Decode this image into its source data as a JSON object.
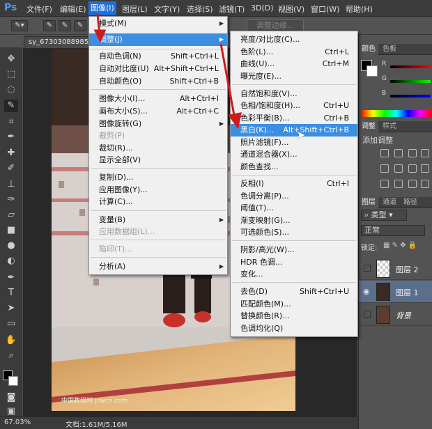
{
  "app": {
    "logo": "Ps"
  },
  "menubar": [
    {
      "label": "文件(F)"
    },
    {
      "label": "编辑(E)"
    },
    {
      "label": "图像(I)"
    },
    {
      "label": "图层(L)"
    },
    {
      "label": "文字(Y)"
    },
    {
      "label": "选择(S)"
    },
    {
      "label": "滤镜(T)"
    },
    {
      "label": "3D(D)"
    },
    {
      "label": "视图(V)"
    },
    {
      "label": "窗口(W)"
    },
    {
      "label": "帮助(H)"
    }
  ],
  "options_bar": {
    "refine_edge": "调整边缘..."
  },
  "document": {
    "tab_title": "sy_67303088985.jpg",
    "watermark": "中国教程网 jcwcn.com"
  },
  "status": {
    "zoom": "67.03%",
    "doc_info": "文档:1.61M/5.16M"
  },
  "image_menu": {
    "items": [
      {
        "label": "模式(M)",
        "shortcut": "",
        "submenu": true
      },
      {
        "label": "调整(J)",
        "shortcut": "",
        "submenu": true,
        "highlighted": true
      },
      {
        "label": "自动色调(N)",
        "shortcut": "Shift+Ctrl+L"
      },
      {
        "label": "自动对比度(U)",
        "shortcut": "Alt+Shift+Ctrl+L"
      },
      {
        "label": "自动颜色(O)",
        "shortcut": "Shift+Ctrl+B"
      },
      {
        "label": "图像大小(I)...",
        "shortcut": "Alt+Ctrl+I"
      },
      {
        "label": "画布大小(S)...",
        "shortcut": "Alt+Ctrl+C"
      },
      {
        "label": "图像旋转(G)",
        "shortcut": "",
        "submenu": true
      },
      {
        "label": "裁剪(P)",
        "shortcut": "",
        "disabled": true
      },
      {
        "label": "裁切(R)...",
        "shortcut": ""
      },
      {
        "label": "显示全部(V)",
        "shortcut": ""
      },
      {
        "label": "复制(D)...",
        "shortcut": ""
      },
      {
        "label": "应用图像(Y)...",
        "shortcut": ""
      },
      {
        "label": "计算(C)...",
        "shortcut": ""
      },
      {
        "label": "变量(B)",
        "shortcut": "",
        "submenu": true
      },
      {
        "label": "应用数据组(L)...",
        "shortcut": "",
        "disabled": true
      },
      {
        "label": "陷印(T)...",
        "shortcut": "",
        "disabled": true
      },
      {
        "label": "分析(A)",
        "shortcut": "",
        "submenu": true
      }
    ]
  },
  "adjust_menu": {
    "items": [
      {
        "label": "亮度/对比度(C)...",
        "shortcut": ""
      },
      {
        "label": "色阶(L)...",
        "shortcut": "Ctrl+L"
      },
      {
        "label": "曲线(U)...",
        "shortcut": "Ctrl+M"
      },
      {
        "label": "曝光度(E)...",
        "shortcut": ""
      },
      {
        "label": "自然饱和度(V)...",
        "shortcut": ""
      },
      {
        "label": "色相/饱和度(H)...",
        "shortcut": "Ctrl+U"
      },
      {
        "label": "色彩平衡(B)...",
        "shortcut": "Ctrl+B"
      },
      {
        "label": "黑白(K)...",
        "shortcut": "Alt+Shift+Ctrl+B",
        "highlighted": true
      },
      {
        "label": "照片滤镜(F)...",
        "shortcut": ""
      },
      {
        "label": "通道混合器(X)...",
        "shortcut": ""
      },
      {
        "label": "颜色查找...",
        "shortcut": ""
      },
      {
        "label": "反相(I)",
        "shortcut": "Ctrl+I"
      },
      {
        "label": "色调分离(P)...",
        "shortcut": ""
      },
      {
        "label": "阈值(T)...",
        "shortcut": ""
      },
      {
        "label": "渐变映射(G)...",
        "shortcut": ""
      },
      {
        "label": "可选颜色(S)...",
        "shortcut": ""
      },
      {
        "label": "阴影/高光(W)...",
        "shortcut": ""
      },
      {
        "label": "HDR 色调...",
        "shortcut": ""
      },
      {
        "label": "变化...",
        "shortcut": ""
      },
      {
        "label": "去色(D)",
        "shortcut": "Shift+Ctrl+U"
      },
      {
        "label": "匹配颜色(M)...",
        "shortcut": ""
      },
      {
        "label": "替换颜色(R)...",
        "shortcut": ""
      },
      {
        "label": "色调均化(Q)",
        "shortcut": ""
      }
    ]
  },
  "color_panel": {
    "tabs": [
      "颜色",
      "色板"
    ],
    "channels": [
      "R",
      "G",
      "B"
    ]
  },
  "adjust_panel": {
    "tabs": [
      "调整",
      "样式"
    ],
    "title": "添加调整"
  },
  "layers_panel": {
    "tabs": [
      "图层",
      "通道",
      "路径"
    ],
    "filter": "类型",
    "blend_mode": "正常",
    "lock_label": "锁定:",
    "layers": [
      {
        "name": "图层 2",
        "visible": false,
        "selected": false
      },
      {
        "name": "图层 1",
        "visible": true,
        "selected": true
      },
      {
        "name": "背景",
        "visible": false,
        "selected": false
      }
    ]
  }
}
